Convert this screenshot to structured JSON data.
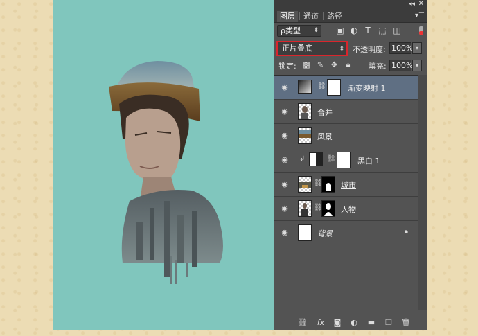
{
  "panel": {
    "collapse_icon": "double-chevron-icon",
    "close_icon": "close-icon",
    "tabs": [
      {
        "label": "图层",
        "active": true
      },
      {
        "label": "通道",
        "active": false
      },
      {
        "label": "路径",
        "active": false
      }
    ],
    "menu_icon": "panel-menu-icon"
  },
  "filter": {
    "kind_label": "ρ类型"
  },
  "blend": {
    "mode": "正片叠底",
    "opacity_label": "不透明度:",
    "opacity_value": "100%"
  },
  "lock": {
    "label": "锁定:",
    "fill_label": "填充:",
    "fill_value": "100%"
  },
  "layers": [
    {
      "name": "渐变映射 1",
      "type": "adjustment",
      "active": true
    },
    {
      "name": "合并",
      "type": "pixel",
      "active": false
    },
    {
      "name": "风景",
      "type": "pixel",
      "active": false
    },
    {
      "name": "黑白 1",
      "type": "adjustment-clipped",
      "active": false
    },
    {
      "name": "城市",
      "type": "masked",
      "active": false
    },
    {
      "name": "人物",
      "type": "masked",
      "active": false
    },
    {
      "name": "背景",
      "type": "background",
      "active": false
    }
  ],
  "bottom_icons": [
    "link-icon",
    "fx-icon",
    "add-mask-icon",
    "adjustment-icon",
    "group-folder-icon",
    "new-layer-icon",
    "trash-icon"
  ],
  "colors": {
    "canvas_bg": "#80c6bd",
    "panel_bg": "#535353",
    "active_layer": "#5f6f83",
    "highlight_border": "#d9262c"
  }
}
